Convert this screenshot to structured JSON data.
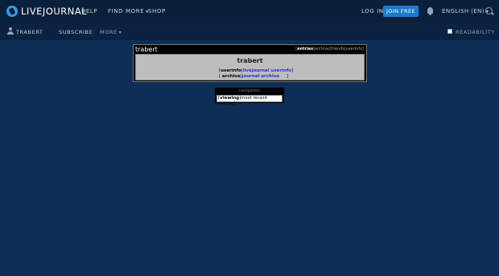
{
  "header": {
    "logo": "LIVEJOURNAL",
    "nav": {
      "help": "HELP",
      "find_more": "FIND MORE",
      "shop": "SHOP"
    },
    "login": "LOG IN",
    "join": "JOIN FREE",
    "language": "ENGLISH (EN)"
  },
  "subheader": {
    "username": "TRABERT",
    "subscribe": "SUBSCRIBE",
    "more": "MORE",
    "readability": "READABILITY"
  },
  "journal": {
    "title": "trabert",
    "tabs": {
      "entries": "entries",
      "archive": "archive",
      "friends": "friends",
      "userinfo": "userinfo"
    },
    "name": "trabert",
    "row1_key": "userinfo",
    "row1_link": "livejournal userinfo",
    "row2_key": "archive",
    "row2_link": "journal archive"
  },
  "navigation": {
    "heading": "navigation",
    "viewing_key": "viewing",
    "viewing_value": "most recent entries"
  },
  "colors": {
    "page_bg": "#0f2e56",
    "topbar_bg": "#0a1f3a",
    "join_button": "#1c7bd0",
    "link": "#2233cc"
  }
}
